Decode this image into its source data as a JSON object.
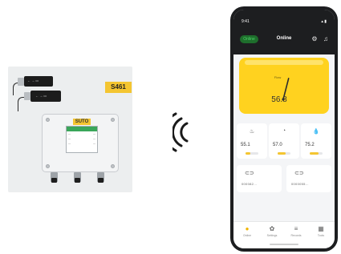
{
  "product": {
    "model_badge": "S461",
    "brand": "SUTO"
  },
  "phone": {
    "status": {
      "time": "9:41",
      "icons": "▴ ▮"
    },
    "header": {
      "online_label": "Online",
      "title": "Online",
      "settings_icon": "gear-icon",
      "notifications_icon": "bell-icon"
    },
    "hero": {
      "label": "Flow",
      "value": "56.8",
      "gauge_fraction": 0.56
    },
    "metrics": [
      {
        "icon": "thermometer-icon",
        "value": "55.1",
        "level": 0.4
      },
      {
        "icon": "pressure-icon",
        "value": "57.0",
        "level": 0.6
      },
      {
        "icon": "humidity-icon",
        "value": "75.2",
        "level": 0.7
      }
    ],
    "sensors": [
      {
        "icon": "sensor-icon",
        "id": "000082…"
      },
      {
        "icon": "sensor-icon",
        "id": "0000055…"
      }
    ],
    "tabs": [
      {
        "icon": "home-icon",
        "label": "Online",
        "active": true
      },
      {
        "icon": "settings-icon",
        "label": "Settings",
        "active": false
      },
      {
        "icon": "chart-icon",
        "label": "Records",
        "active": false
      },
      {
        "icon": "grid-icon",
        "label": "Tools",
        "active": false
      }
    ]
  },
  "colors": {
    "accent": "#ffd21f",
    "dark": "#1d1e20",
    "online_green": "#4ed46a"
  }
}
